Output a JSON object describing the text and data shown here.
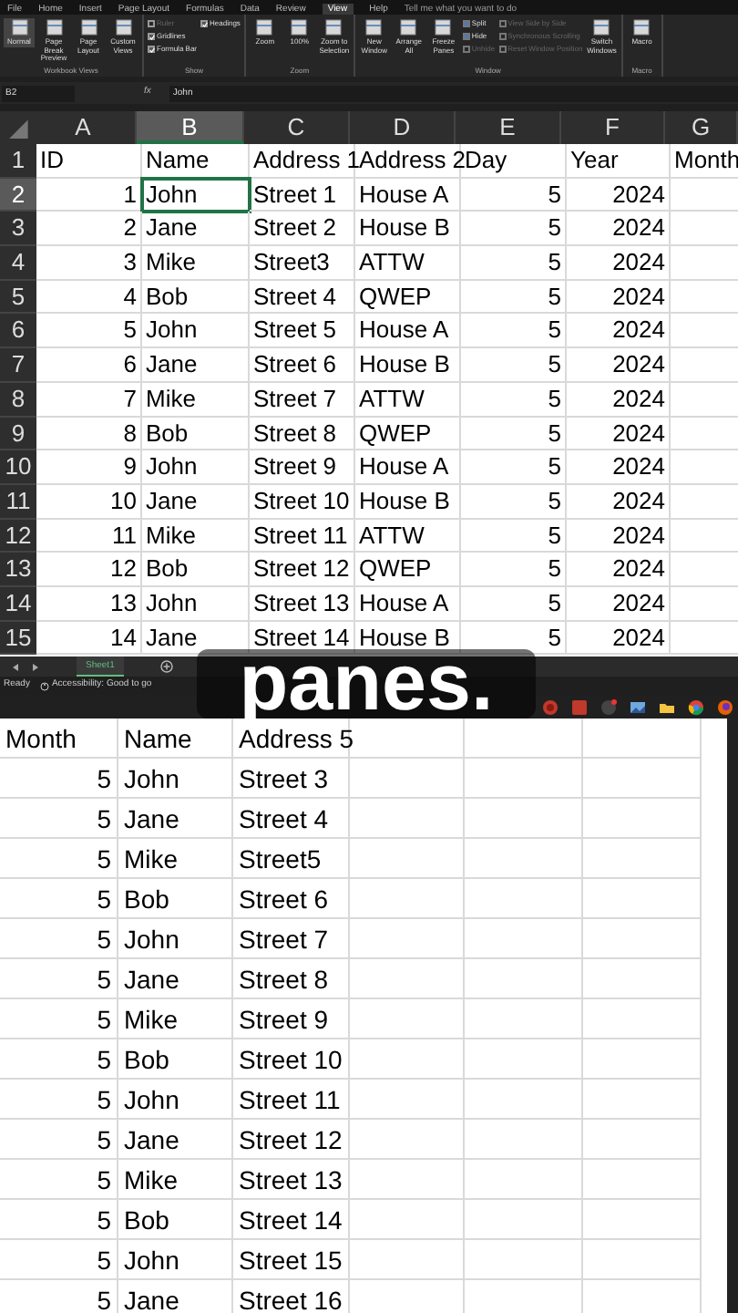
{
  "menu_tabs": [
    {
      "label": "File",
      "selected": false
    },
    {
      "label": "Home",
      "selected": false
    },
    {
      "label": "Insert",
      "selected": false
    },
    {
      "label": "Page Layout",
      "selected": false
    },
    {
      "label": "Formulas",
      "selected": false
    },
    {
      "label": "Data",
      "selected": false
    },
    {
      "label": "Review",
      "selected": false
    },
    {
      "label": "View",
      "selected": true
    },
    {
      "label": "Help",
      "selected": false
    }
  ],
  "tell_me": "Tell me what you want to do",
  "ribbon_groups": [
    {
      "label": "Workbook Views",
      "items": [
        {
          "kind": "large",
          "label": "Normal",
          "selected": true
        },
        {
          "kind": "large",
          "label": "Page Break Preview",
          "selected": false
        },
        {
          "kind": "large",
          "label": "Page Layout",
          "selected": false
        },
        {
          "kind": "large",
          "label": "Custom Views",
          "selected": false
        }
      ]
    },
    {
      "label": "Show",
      "items": [
        {
          "kind": "check",
          "label": "Ruler",
          "checked": false,
          "disabled": true
        },
        {
          "kind": "check",
          "label": "Gridlines",
          "checked": true,
          "disabled": false
        },
        {
          "kind": "check",
          "label": "Formula Bar",
          "checked": true,
          "disabled": false
        },
        {
          "kind": "check",
          "label": "Headings",
          "checked": true,
          "disabled": false
        }
      ]
    },
    {
      "label": "Zoom",
      "items": [
        {
          "kind": "large",
          "label": "Zoom",
          "selected": false
        },
        {
          "kind": "large",
          "label": "100%",
          "selected": false
        },
        {
          "kind": "large",
          "label": "Zoom to Selection",
          "selected": false
        }
      ]
    },
    {
      "label": "Window",
      "items": [
        {
          "kind": "large",
          "label": "New Window",
          "selected": false
        },
        {
          "kind": "large",
          "label": "Arrange All",
          "selected": false
        },
        {
          "kind": "large",
          "label": "Freeze Panes",
          "selected": false
        },
        {
          "kind": "small",
          "label": "Split",
          "disabled": false
        },
        {
          "kind": "small",
          "label": "Hide",
          "disabled": false
        },
        {
          "kind": "small",
          "label": "Unhide",
          "disabled": true
        },
        {
          "kind": "small",
          "label": "View Side by Side",
          "disabled": true
        },
        {
          "kind": "small",
          "label": "Synchronous Scrolling",
          "disabled": true
        },
        {
          "kind": "small",
          "label": "Reset Window Position",
          "disabled": true
        },
        {
          "kind": "large",
          "label": "Switch Windows",
          "selected": false
        }
      ]
    },
    {
      "label": "Macro",
      "items": [
        {
          "kind": "large",
          "label": "Macro",
          "selected": false
        }
      ]
    }
  ],
  "formula_bar": {
    "name_box": "B2",
    "function_label": "fx",
    "value": "John"
  },
  "sheet": {
    "columns": [
      {
        "label": "A",
        "selected": false
      },
      {
        "label": "B",
        "selected": true
      },
      {
        "label": "C",
        "selected": false
      },
      {
        "label": "D",
        "selected": false
      },
      {
        "label": "E",
        "selected": false
      },
      {
        "label": "F",
        "selected": false
      },
      {
        "label": "G",
        "selected": false
      }
    ],
    "rows": [
      {
        "number": "1",
        "selected": false,
        "cells": [
          "ID",
          "Name",
          "Address 1",
          "Address 2",
          "Day",
          "Year",
          "Month"
        ]
      },
      {
        "number": "2",
        "selected": true,
        "cells": [
          "1",
          "John",
          "Street 1",
          "House A",
          "5",
          "2024",
          ""
        ]
      },
      {
        "number": "3",
        "selected": false,
        "cells": [
          "2",
          "Jane",
          "Street 2",
          "House B",
          "5",
          "2024",
          ""
        ]
      },
      {
        "number": "4",
        "selected": false,
        "cells": [
          "3",
          "Mike",
          "Street3",
          "ATTW",
          "5",
          "2024",
          ""
        ]
      },
      {
        "number": "5",
        "selected": false,
        "cells": [
          "4",
          "Bob",
          "Street 4",
          "QWEP",
          "5",
          "2024",
          ""
        ]
      },
      {
        "number": "6",
        "selected": false,
        "cells": [
          "5",
          "John",
          "Street 5",
          "House A",
          "5",
          "2024",
          ""
        ]
      },
      {
        "number": "7",
        "selected": false,
        "cells": [
          "6",
          "Jane",
          "Street 6",
          "House B",
          "5",
          "2024",
          ""
        ]
      },
      {
        "number": "8",
        "selected": false,
        "cells": [
          "7",
          "Mike",
          "Street 7",
          "ATTW",
          "5",
          "2024",
          ""
        ]
      },
      {
        "number": "9",
        "selected": false,
        "cells": [
          "8",
          "Bob",
          "Street 8",
          "QWEP",
          "5",
          "2024",
          ""
        ]
      },
      {
        "number": "10",
        "selected": false,
        "cells": [
          "9",
          "John",
          "Street 9",
          "House A",
          "5",
          "2024",
          ""
        ]
      },
      {
        "number": "11",
        "selected": false,
        "cells": [
          "10",
          "Jane",
          "Street 10",
          "House B",
          "5",
          "2024",
          ""
        ]
      },
      {
        "number": "12",
        "selected": false,
        "cells": [
          "11",
          "Mike",
          "Street 11",
          "ATTW",
          "5",
          "2024",
          ""
        ]
      },
      {
        "number": "13",
        "selected": false,
        "cells": [
          "12",
          "Bob",
          "Street 12",
          "QWEP",
          "5",
          "2024",
          ""
        ]
      },
      {
        "number": "14",
        "selected": false,
        "cells": [
          "13",
          "John",
          "Street 13",
          "House A",
          "5",
          "2024",
          ""
        ]
      },
      {
        "number": "15",
        "selected": false,
        "cells": [
          "14",
          "Jane",
          "Street 14",
          "House B",
          "5",
          "2024",
          ""
        ]
      }
    ],
    "tabs": [
      {
        "label": "Sheet1",
        "selected": true
      }
    ]
  },
  "status_bar": {
    "mode": "Ready",
    "accessibility": "Accessibility: Good to go"
  },
  "second_sheet": {
    "header": [
      "Month",
      "Name",
      "Address 5"
    ],
    "rows": [
      [
        "5",
        "John",
        "Street 3"
      ],
      [
        "5",
        "Jane",
        "Street 4"
      ],
      [
        "5",
        "Mike",
        "Street5"
      ],
      [
        "5",
        "Bob",
        "Street 6"
      ],
      [
        "5",
        "John",
        "Street 7"
      ],
      [
        "5",
        "Jane",
        "Street 8"
      ],
      [
        "5",
        "Mike",
        "Street 9"
      ],
      [
        "5",
        "Bob",
        "Street 10"
      ],
      [
        "5",
        "John",
        "Street 11"
      ],
      [
        "5",
        "Jane",
        "Street 12"
      ],
      [
        "5",
        "Mike",
        "Street 13"
      ],
      [
        "5",
        "Bob",
        "Street 14"
      ],
      [
        "5",
        "John",
        "Street 15"
      ],
      [
        "5",
        "Jane",
        "Street 16"
      ]
    ]
  },
  "caption": "panes."
}
